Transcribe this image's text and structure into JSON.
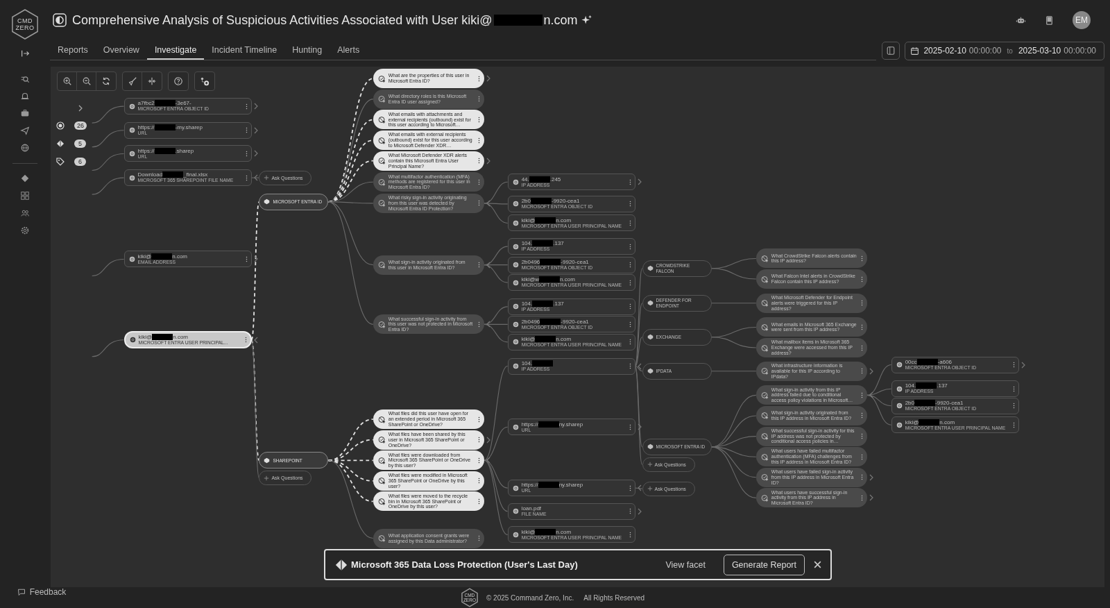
{
  "sidebar": {
    "logo": [
      "CMD",
      "ZERO"
    ],
    "feedback": "Feedback"
  },
  "header": {
    "title": "Comprehensive Analysis of Suspicious Activities Associated with User kiki@",
    "title_end": "n.com",
    "title_redacted": true,
    "avatar": "EM"
  },
  "tabs": [
    {
      "label": "Reports",
      "selected": false
    },
    {
      "label": "Overview",
      "selected": false
    },
    {
      "label": "Investigate",
      "selected": true
    },
    {
      "label": "Incident Timeline",
      "selected": false
    },
    {
      "label": "Hunting",
      "selected": false
    },
    {
      "label": "Alerts",
      "selected": false
    }
  ],
  "date_range": {
    "start_date": "2025-02-10",
    "start_time": "00:00:00",
    "separator": "to",
    "end_date": "2025-03-10",
    "end_time": "00:00:00"
  },
  "legend": [
    {
      "kind": "target",
      "count": "26"
    },
    {
      "kind": "diamond",
      "count": "5"
    },
    {
      "kind": "tag",
      "count": "6"
    }
  ],
  "graph": {
    "nodes": [
      {
        "kind": "entity",
        "value": "a7fbc2",
        "value_end": "-3e67-",
        "redacted": true,
        "type": "MICROSOFT ENTRA OBJECT ID",
        "selected": false,
        "expanded": false
      },
      {
        "kind": "entity",
        "value": "https://",
        "value_end": "-my.sharep",
        "redacted": true,
        "type": "URL",
        "selected": false,
        "expanded": false
      },
      {
        "kind": "entity",
        "value": "https://",
        "value_end": ".sharep",
        "redacted": true,
        "type": "URL",
        "selected": false,
        "expanded": false
      },
      {
        "kind": "entity",
        "value": "Download",
        "value_end": "_final.xlsx",
        "redacted": true,
        "type": "MICROSOFT 365 SHAREPOINT FILE NAME",
        "selected": false,
        "expanded": true,
        "children": [
          {
            "kind": "ask",
            "label": "Ask Questions"
          }
        ]
      },
      {
        "kind": "entity",
        "value": "kiki@",
        "value_end": "n.com",
        "redacted": true,
        "type": "EMAIL ADDRESS",
        "selected": false,
        "expanded": false
      },
      {
        "kind": "entity",
        "value": "kiki@",
        "value_end": "n.com",
        "redacted": true,
        "type": "MICROSOFT ENTRA USER PRINCIPAL...",
        "selected": true,
        "expanded": true,
        "children": [
          {
            "kind": "source",
            "label": "MICROSOFT ENTRA ID",
            "active": true,
            "children": [
              {
                "kind": "question",
                "text": "What are the properties of this user in Microsoft Entra ID?",
                "active": true,
                "available": true,
                "expanded": false
              },
              {
                "kind": "question",
                "text": "What directory roles is this Microsoft Entra ID user assigned?",
                "active": false,
                "available": true
              },
              {
                "kind": "question",
                "text": "What emails with attachments and external recipients (outbound) exist for this user according to Microsoft…",
                "active": true,
                "available": false
              },
              {
                "kind": "question",
                "text": "What emails with external recipients (outbound) exist for this user according to Microsoft Defender XDR…",
                "active": true,
                "available": false
              },
              {
                "kind": "question",
                "text": "What Microsoft Defender XDR alerts contain this Microsoft Entra User Principal Name?",
                "active": true,
                "available": true,
                "expanded": false
              },
              {
                "kind": "question",
                "text": "What multifactor authentication (MFA) methods are registered for this user in Microsoft Entra ID?",
                "active": false,
                "available": true
              },
              {
                "kind": "question",
                "text": "What risky sign-in activity originating from this user was detected by Microsoft Entra ID Protection?",
                "active": false,
                "available": true,
                "expanded": true,
                "children": [
                  {
                    "kind": "entity",
                    "value": "44.",
                    "value_end": ".245",
                    "redacted": true,
                    "type": "IP ADDRESS",
                    "selected": false,
                    "expanded": false
                  },
                  {
                    "kind": "entity",
                    "value": "2b0",
                    "value_end": "-9920-cea1",
                    "redacted": true,
                    "type": "MICROSOFT ENTRA OBJECT ID",
                    "selected": false
                  },
                  {
                    "kind": "entity",
                    "value": "kiki@",
                    "value_end": "n.com",
                    "redacted": true,
                    "type": "MICROSOFT ENTRA USER PRINCIPAL NAME",
                    "selected": false
                  }
                ]
              },
              {
                "kind": "question",
                "text": "What sign-in activity originated from this user in Microsoft Entra ID?",
                "active": false,
                "available": true,
                "expanded": true,
                "children": [
                  {
                    "kind": "entity",
                    "value": "104.",
                    "value_end": ".137",
                    "redacted": true,
                    "type": "IP ADDRESS",
                    "selected": false
                  },
                  {
                    "kind": "entity",
                    "value": "2b0496",
                    "value_end": "-9920-cea1",
                    "redacted": true,
                    "type": "MICROSOFT ENTRA OBJECT ID",
                    "selected": false
                  },
                  {
                    "kind": "entity",
                    "value": "kiki@w",
                    "value_end": "n.com",
                    "redacted": true,
                    "type": "MICROSOFT ENTRA USER PRINCIPAL NAME",
                    "selected": false
                  }
                ]
              },
              {
                "kind": "question",
                "text": "What successful sign-in activity from this user was not protected in Microsoft Entra ID?",
                "active": false,
                "available": true,
                "expanded": true,
                "children": [
                  {
                    "kind": "entity",
                    "value": "104.",
                    "value_end": ".137",
                    "redacted": true,
                    "type": "IP ADDRESS",
                    "selected": false
                  },
                  {
                    "kind": "entity",
                    "value": "2b0496",
                    "value_end": "-9920-cea1",
                    "redacted": true,
                    "type": "MICROSOFT ENTRA OBJECT ID",
                    "selected": false
                  },
                  {
                    "kind": "entity",
                    "value": "kiki@",
                    "value_end": "n.com",
                    "redacted": true,
                    "type": "MICROSOFT ENTRA USER PRINCIPAL NAME",
                    "selected": false
                  }
                ]
              }
            ]
          },
          {
            "kind": "source",
            "label": "SHAREPOINT",
            "active": true,
            "children": [
              {
                "kind": "question",
                "text": "What files did this user have open for an extended period in Microsoft 365 SharePoint or OneDrive?",
                "active": true,
                "available": false
              },
              {
                "kind": "question",
                "text": "What files have been shared by this user in Microsoft 365 SharePoint or OneDrive?",
                "active": true,
                "available": true,
                "expanded": false
              },
              {
                "kind": "question",
                "text": "What files were downloaded from Microsoft 365 SharePoint or OneDrive by this user?",
                "active": true,
                "available": true,
                "expanded": true,
                "children": [
                  {
                    "kind": "entity",
                    "value": "104.",
                    "redacted": true,
                    "type": "IP ADDRESS",
                    "selected": false,
                    "expanded": true,
                    "children": [
                      {
                        "kind": "source",
                        "label": "CROWDSTRIKE FALCON",
                        "active": false,
                        "children": [
                          {
                            "kind": "question",
                            "text": "What CrowdStrike Falcon alerts contain this IP address?",
                            "active": false,
                            "available": false
                          },
                          {
                            "kind": "question",
                            "text": "What Falcon Intel alerts in CrowdStrike Falcon contain this IP address?",
                            "active": false,
                            "available": false
                          }
                        ]
                      },
                      {
                        "kind": "source",
                        "label": "DEFENDER FOR ENDPOINT",
                        "active": false,
                        "children": [
                          {
                            "kind": "question",
                            "text": "What Microsoft Defender for Endpoint alerts were triggered for this IP address?",
                            "active": false,
                            "available": false
                          }
                        ]
                      },
                      {
                        "kind": "source",
                        "label": "EXCHANGE",
                        "active": false,
                        "children": [
                          {
                            "kind": "question",
                            "text": "What emails in Microsoft 365 Exchange were sent from this IP address?",
                            "active": false,
                            "available": false
                          },
                          {
                            "kind": "question",
                            "text": "What mailbox items in Microsoft 365 Exchange were accessed from this IP address?",
                            "active": false,
                            "available": false
                          }
                        ]
                      },
                      {
                        "kind": "source",
                        "label": "IPDATA",
                        "active": false,
                        "children": [
                          {
                            "kind": "question",
                            "text": "What infrastructure information is available for this IP according to IPdata?",
                            "active": false,
                            "available": true,
                            "expanded": false
                          }
                        ]
                      },
                      {
                        "kind": "source",
                        "label": "MICROSOFT ENTRA ID",
                        "active": false,
                        "children": [
                          {
                            "kind": "question",
                            "text": "What sign-in activity from this IP address failed due to conditional access policy violations in Microsoft…",
                            "active": false,
                            "available": true,
                            "expanded": true,
                            "children": [
                              {
                                "kind": "entity",
                                "value": "00cc",
                                "value_end": "-a606",
                                "redacted": true,
                                "type": "MICROSOFT ENTRA OBJECT ID",
                                "selected": false,
                                "expanded": false
                              },
                              {
                                "kind": "entity",
                                "value": "104.",
                                "value_end": ".137",
                                "redacted": true,
                                "type": "IP ADDRESS",
                                "selected": false
                              },
                              {
                                "kind": "entity",
                                "value": "2b0",
                                "value_end": "-9920-cea1",
                                "redacted": true,
                                "type": "MICROSOFT ENTRA OBJECT ID",
                                "selected": false
                              },
                              {
                                "kind": "entity",
                                "value": "kiki@",
                                "value_end": "n.com",
                                "redacted": true,
                                "type": "MICROSOFT ENTRA USER PRINCIPAL NAME",
                                "selected": false
                              }
                            ]
                          },
                          {
                            "kind": "question",
                            "text": "What sign-in activity originated from this IP address in Microsoft Entra ID?",
                            "active": false,
                            "available": false
                          },
                          {
                            "kind": "question",
                            "text": "What successful sign-in activity for this IP address was not protected by conditional access policies in…",
                            "active": false,
                            "available": false
                          },
                          {
                            "kind": "question",
                            "text": "What users have failed multifactor authentication (MFA) challenges from this IP address in Microsoft Entra ID?",
                            "active": false,
                            "available": false
                          },
                          {
                            "kind": "question",
                            "text": "What users have failed sign-in activity from this IP address in Microsoft Entra ID?",
                            "active": false,
                            "available": true,
                            "expanded": false
                          },
                          {
                            "kind": "question",
                            "text": "What users have successful sign-in activity from this IP address in Microsoft Entra ID?",
                            "active": false,
                            "available": true,
                            "expanded": false
                          }
                        ]
                      },
                      {
                        "kind": "ask",
                        "label": "Ask Questions"
                      }
                    ]
                  },
                  {
                    "kind": "entity",
                    "value": "https://",
                    "value_end": "ny.sharep",
                    "redacted": true,
                    "type": "URL",
                    "selected": false,
                    "expanded": false
                  },
                  {
                    "kind": "entity",
                    "value": "https://",
                    "value_end": "ny.sharep",
                    "redacted": true,
                    "type": "URL",
                    "selected": false,
                    "expanded": true,
                    "children": [
                      {
                        "kind": "ask",
                        "label": "Ask Questions"
                      }
                    ]
                  },
                  {
                    "kind": "entity",
                    "value": "loan.pdf",
                    "redacted": false,
                    "type": "FILE NAME",
                    "selected": false,
                    "expanded": false
                  },
                  {
                    "kind": "entity",
                    "value": "kiki@",
                    "value_end": "n.com",
                    "redacted": true,
                    "type": "MICROSOFT ENTRA USER PRINCIPAL NAME",
                    "selected": false
                  }
                ]
              },
              {
                "kind": "question",
                "text": "What files were modified in Microsoft 365 SharePoint or OneDrive by this user?",
                "active": true,
                "available": false
              },
              {
                "kind": "question",
                "text": "What files were moved to the recycle bin in Microsoft 365 SharePoint or OneDrive by this user?",
                "active": true,
                "available": false
              },
              {
                "kind": "question",
                "text": "What application consent grants were assigned by this Data administrator?",
                "active": false,
                "available": false
              }
            ]
          },
          {
            "kind": "ask",
            "label": "Ask Questions"
          }
        ]
      }
    ]
  },
  "banner": {
    "title": "Microsoft 365 Data Loss Protection (User's Last Day)",
    "view_link": "View facet",
    "action": "Generate Report"
  },
  "footer": {
    "logo": [
      "CMD",
      "ZERO"
    ],
    "copyright": "© 2025 Command Zero, Inc.",
    "rights": "All Rights Reserved"
  }
}
